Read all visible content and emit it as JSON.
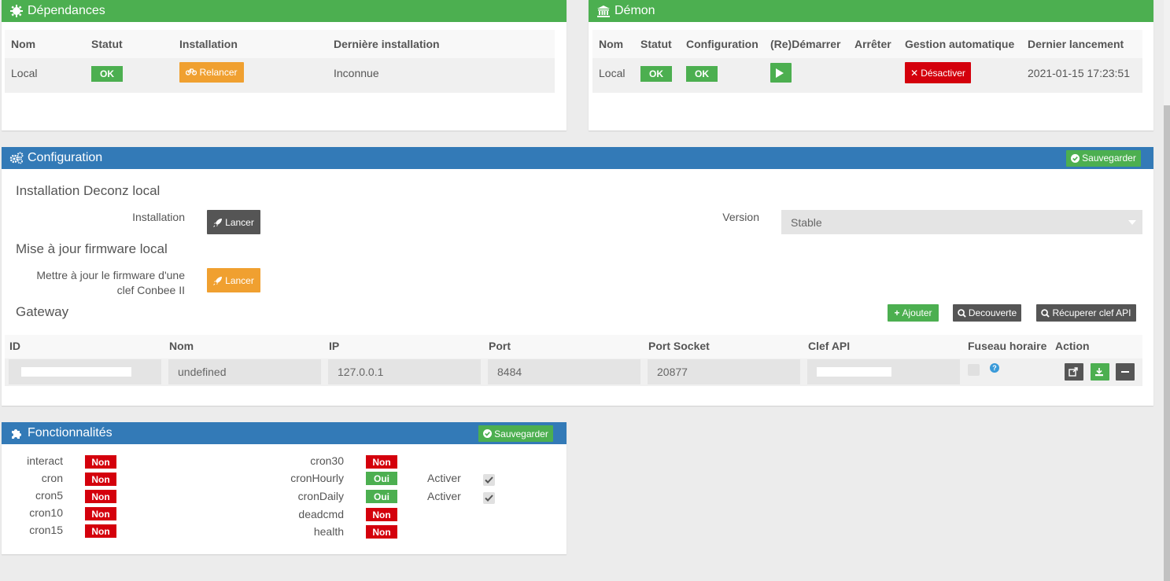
{
  "deps": {
    "title": "Dépendances",
    "headers": [
      "Nom",
      "Statut",
      "Installation",
      "Dernière installation"
    ],
    "row": {
      "nom": "Local",
      "statut": "OK",
      "install_btn": "Relancer",
      "derniere": "Inconnue"
    }
  },
  "daemon": {
    "title": "Démon",
    "headers": [
      "Nom",
      "Statut",
      "Configuration",
      "(Re)Démarrer",
      "Arrêter",
      "Gestion automatique",
      "Dernier lancement"
    ],
    "row": {
      "nom": "Local",
      "statut": "OK",
      "config": "OK",
      "gestion_btn": "Désactiver",
      "dernier": "2021-01-15 17:23:51"
    }
  },
  "config": {
    "title": "Configuration",
    "save_label": "Sauvegarder",
    "install_section": "Installation Deconz local",
    "install_label": "Installation",
    "launch_label": "Lancer",
    "version_label": "Version",
    "version_value": "Stable",
    "firmware_section": "Mise à jour firmware local",
    "firmware_label_1": "Mettre à jour le firmware d'une",
    "firmware_label_2": "clef Conbee II",
    "gateway_section": "Gateway",
    "add_btn": "Ajouter",
    "discover_btn": "Decouverte",
    "apikey_btn": "Récuperer clef API",
    "gw_headers": [
      "ID",
      "Nom",
      "IP",
      "Port",
      "Port Socket",
      "Clef API",
      "Fuseau horaire",
      "Action"
    ],
    "gw_row": {
      "nom": "undefined",
      "ip": "127.0.0.1",
      "port": "8484",
      "port_socket": "20877"
    }
  },
  "features": {
    "title": "Fonctionnalités",
    "save_label": "Sauvegarder",
    "left": [
      {
        "name": "interact",
        "value": "Non"
      },
      {
        "name": "cron",
        "value": "Non"
      },
      {
        "name": "cron5",
        "value": "Non"
      },
      {
        "name": "cron10",
        "value": "Non"
      },
      {
        "name": "cron15",
        "value": "Non"
      }
    ],
    "right": [
      {
        "name": "cron30",
        "value": "Non"
      },
      {
        "name": "cronHourly",
        "value": "Oui",
        "extra": "Activer"
      },
      {
        "name": "cronDaily",
        "value": "Oui",
        "extra": "Activer"
      },
      {
        "name": "deadcmd",
        "value": "Non"
      },
      {
        "name": "health",
        "value": "Non"
      }
    ]
  },
  "colors": {
    "green": "#4caf50",
    "blue": "#337ab7",
    "orange": "#f0a030",
    "red": "#d4000c",
    "dark": "#555555"
  },
  "icons": [
    "gear-icon",
    "bank-icon",
    "cogs-icon",
    "puzzle-icon",
    "bicycle-icon",
    "play-icon",
    "times-icon",
    "check-circle-icon",
    "rocket-icon",
    "plus-icon",
    "search-icon",
    "external-link-icon",
    "download-icon",
    "minus-icon",
    "question-icon",
    "checkmark-icon",
    "caret-down-icon"
  ]
}
